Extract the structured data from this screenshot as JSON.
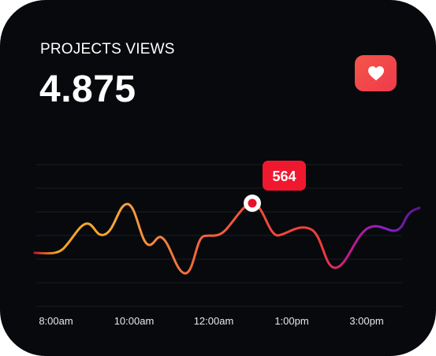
{
  "card": {
    "title": "PROJECTS VIEWS",
    "value": "4.875",
    "like_icon": "heart-icon"
  },
  "colors": {
    "background": "#07090d",
    "accent": "#f0394a",
    "line_start": "#f5a623",
    "line_mid": "#f04a3a",
    "line_end": "#7a1fd0",
    "tooltip": "#f0182f"
  },
  "chart_data": {
    "type": "line",
    "title": "",
    "xlabel": "",
    "ylabel": "",
    "x_tick_labels": [
      "8:00am",
      "10:00am",
      "12:00am",
      "1:00pm",
      "3:00pm"
    ],
    "grid": true,
    "highlighted_point": {
      "label": "564"
    }
  }
}
